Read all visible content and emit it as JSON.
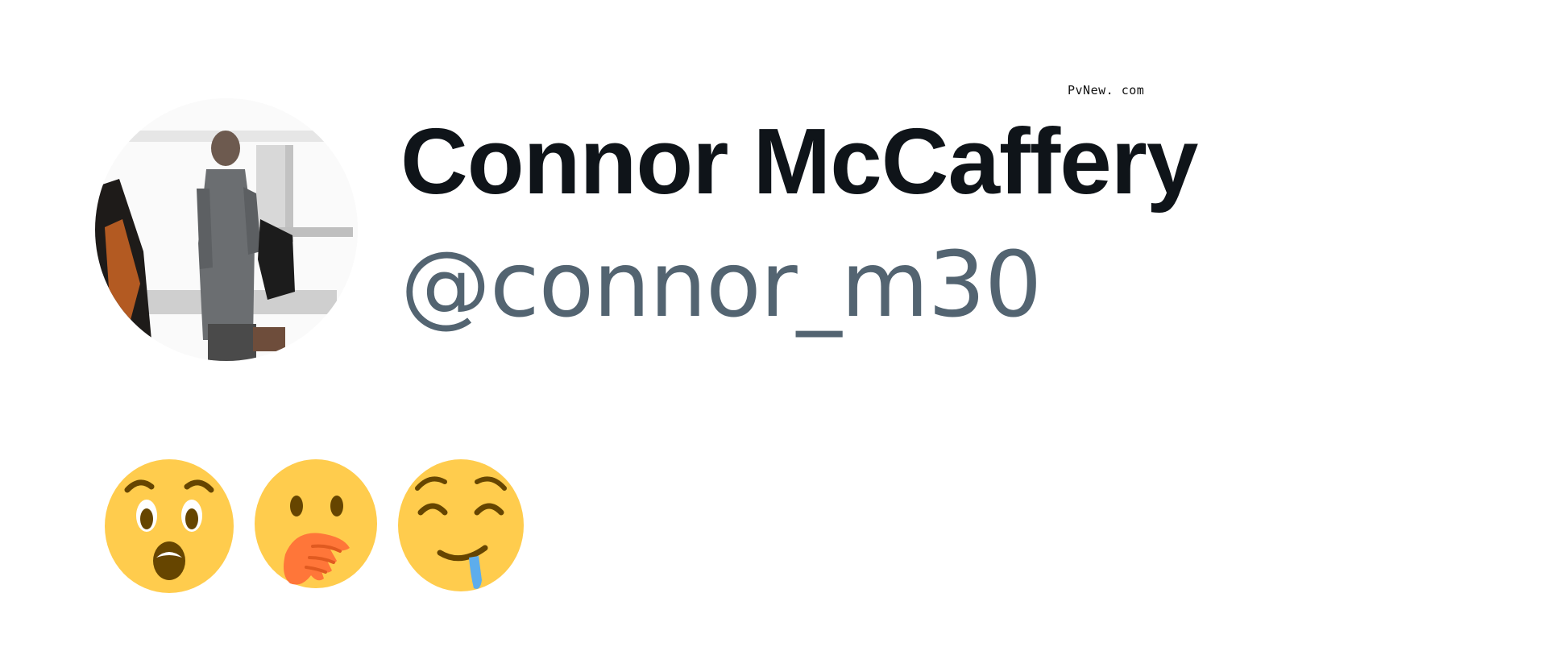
{
  "watermark": "PvNew. com",
  "profile": {
    "display_name": "Connor McCaffery",
    "handle": "@connor_m30",
    "avatar_icon": "profile-photo"
  },
  "emojis": [
    {
      "name": "astonished-face-emoji"
    },
    {
      "name": "face-with-hand-over-mouth-emoji"
    },
    {
      "name": "drooling-face-emoji"
    }
  ],
  "colors": {
    "name": "#0f1419",
    "handle": "#536471",
    "emoji_face": "#FFCC4D",
    "emoji_hand": "#FF7639",
    "emoji_drool": "#5DADEC"
  }
}
